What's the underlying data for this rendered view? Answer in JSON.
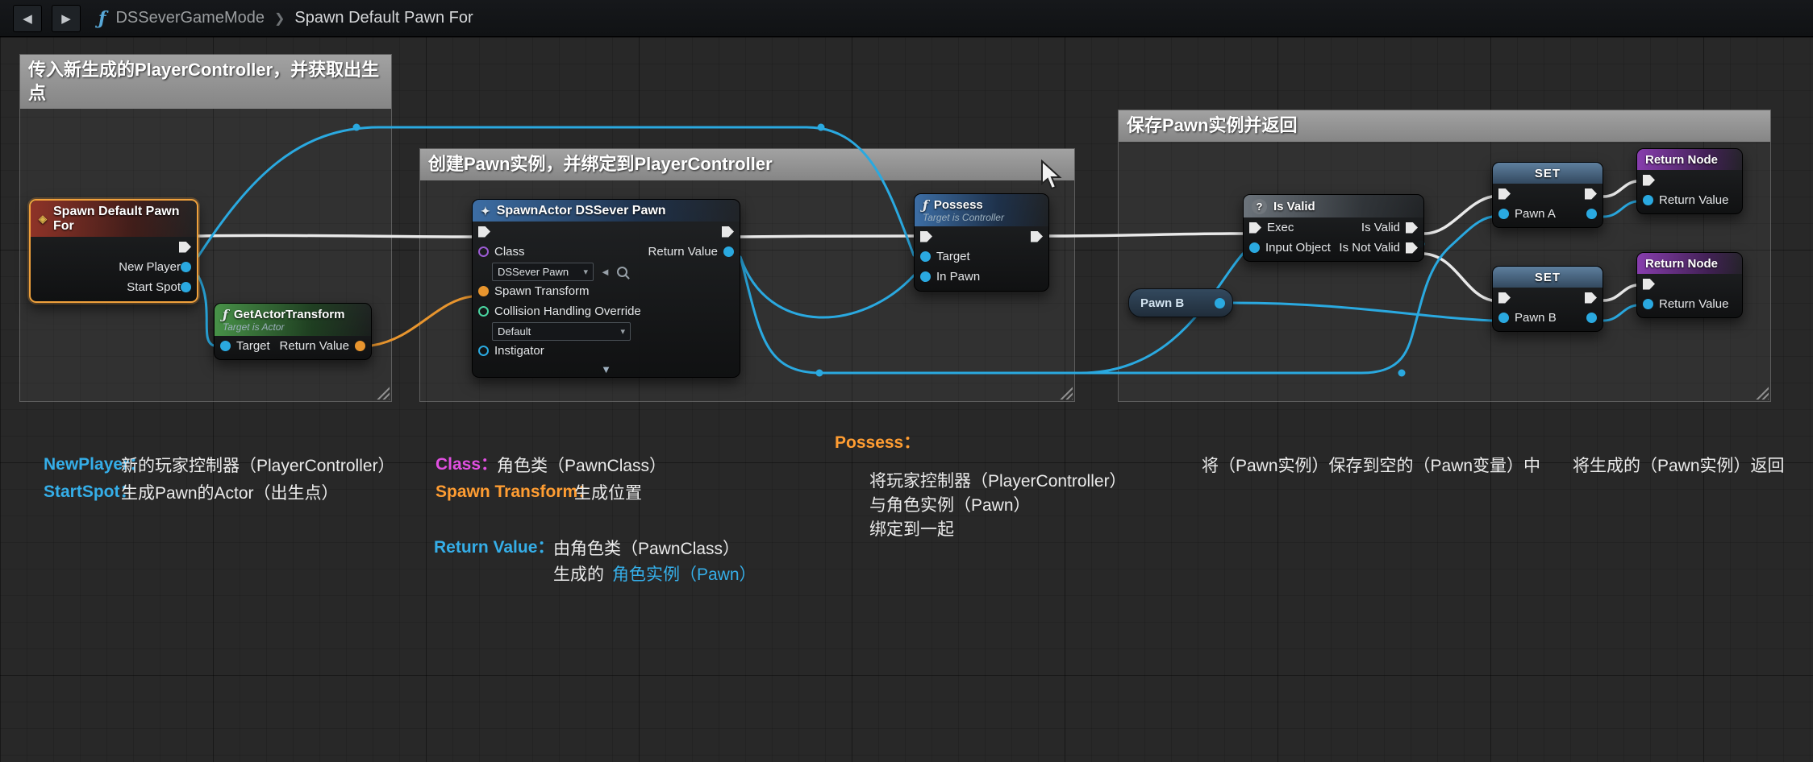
{
  "breadcrumb": {
    "back": "◀",
    "forward": "▶",
    "fn_icon": "ƒ",
    "parent": "DSSeverGameMode",
    "separator": "❯",
    "current": "Spawn Default Pawn For"
  },
  "comments": [
    {
      "title": "传入新生成的PlayerController，并获取出生点"
    },
    {
      "title": "创建Pawn实例，并绑定到PlayerController"
    },
    {
      "title": "保存Pawn实例并返回"
    }
  ],
  "nodes": {
    "event": {
      "title": "Spawn Default Pawn For",
      "new_player": "New Player",
      "start_spot": "Start Spot"
    },
    "get_actor_transform": {
      "fn_icon": "ƒ",
      "title": "GetActorTransform",
      "subtitle": "Target is Actor",
      "target": "Target",
      "return_value": "Return Value"
    },
    "spawn_actor": {
      "title": "SpawnActor DSSever Pawn",
      "class_label": "Class",
      "class_value": "DSSever Pawn",
      "return_value": "Return Value",
      "spawn_transform": "Spawn Transform",
      "collision": "Collision Handling Override",
      "collision_value": "Default",
      "instigator": "Instigator",
      "collapse": "▼",
      "caret": "▾"
    },
    "possess": {
      "fn_icon": "ƒ",
      "title": "Possess",
      "subtitle": "Target is Controller",
      "target": "Target",
      "in_pawn": "In Pawn"
    },
    "is_valid": {
      "icon": "?",
      "title": "Is Valid",
      "exec": "Exec",
      "input_object": "Input Object",
      "is_valid": "Is Valid",
      "is_not_valid": "Is Not Valid"
    },
    "pawn_b_get": {
      "title": "Pawn B"
    },
    "set_a": {
      "title": "SET",
      "pin": "Pawn A"
    },
    "set_b": {
      "title": "SET",
      "pin": "Pawn B"
    },
    "return_1": {
      "title": "Return Node",
      "pin": "Return Value"
    },
    "return_2": {
      "title": "Return Node",
      "pin": "Return Value"
    }
  },
  "annotations": {
    "new_player_label": "NewPlayer：",
    "new_player_text": "新的玩家控制器（PlayerController）",
    "start_spot_label": "StartSpot：",
    "start_spot_text": "生成Pawn的Actor（出生点）",
    "class_label": "Class：",
    "class_text": "角色类（PawnClass）",
    "spawn_transform_label": "Spawn Transform：",
    "spawn_transform_text": "生成位置",
    "return_value_label": "Return Value：",
    "rv_line1": "由角色类（PawnClass）",
    "rv_line2_prefix": "生成的",
    "rv_line2_highlight": "角色实例（Pawn）",
    "possess_label": "Possess：",
    "possess_line1": "将玩家控制器（PlayerController）",
    "possess_line2": "与角色实例（Pawn）",
    "possess_line3": "绑定到一起",
    "save_text": "将（Pawn实例）保存到空的（Pawn变量）中",
    "return_text": "将生成的（Pawn实例）返回"
  },
  "colors": {
    "exec_wire": "#e9e9e9",
    "data_wire": "#2aa9e0",
    "transform_wire": "#e8952e",
    "class_pin": "#9c5bd4",
    "enum_pin": "#4ad4a0",
    "selection": "#f0a13c"
  }
}
